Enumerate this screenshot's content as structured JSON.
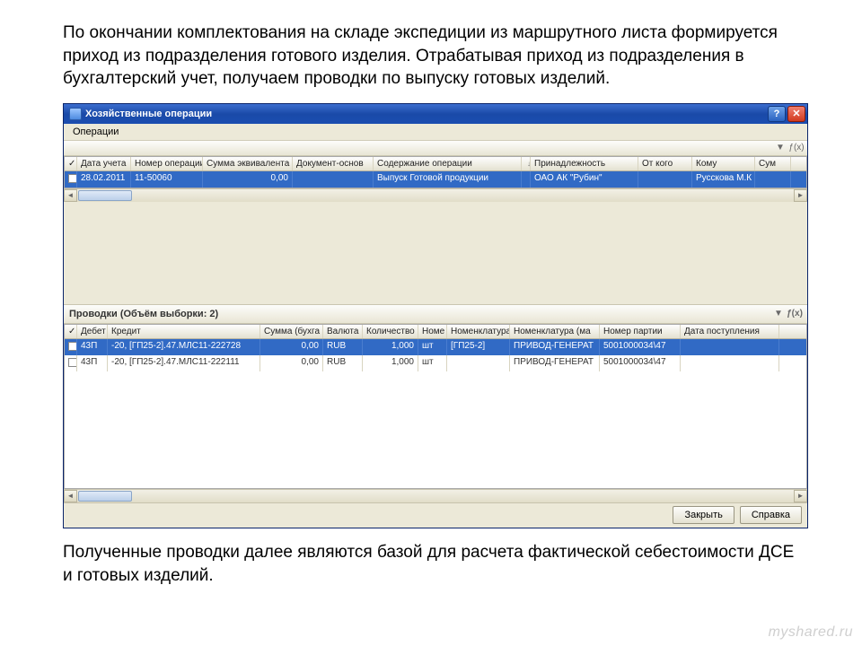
{
  "intro_text": "По окончании комплектования на складе экспедиции из маршрутного листа формируется приход из подразделения готового изделия. Отрабатывая приход из подразделения в бухгалтерский учет, получаем проводки по выпуску готовых изделий.",
  "outro_text": "Полученные проводки далее являются базой для расчета фактической себестоимости ДСЕ и готовых изделий.",
  "watermark": "myshared.ru",
  "window": {
    "title": "Хозяйственные операции",
    "menu": {
      "operations": "Операции"
    }
  },
  "toolbar": {
    "filter_icon": "▼",
    "fx_icon": "ƒ(x)"
  },
  "grid1": {
    "headers": {
      "check": "✓",
      "date": "Дата учета",
      "num": "Номер операции",
      "sum": "Сумма эквивалента",
      "doc": "Документ-основ",
      "content": "Содержание операции",
      "sort": "↓",
      "owner": "Принадлежность",
      "from": "От кого",
      "to": "Кому",
      "sumcol": "Сум"
    },
    "row": {
      "date": "28.02.2011",
      "num": "11-50060",
      "sum": "0,00",
      "doc": "",
      "content": "Выпуск Готовой продукции",
      "owner": "ОАО АК \"Рубин\"",
      "from": "",
      "to": "Русскова М.К",
      "sumcol": ""
    }
  },
  "panel2_title": "Проводки (Объём выборки: 2)",
  "grid2": {
    "headers": {
      "check": "✓",
      "debit": "Дебет",
      "credit": "Кредит",
      "sum": "Сумма (бухга",
      "currency": "Валюта",
      "qty": "Количество",
      "unit": "Номе",
      "nomen": "Номенклатура",
      "nomen_m": "Номенклатура (ма",
      "batch": "Номер партии",
      "date_in": "Дата поступления"
    },
    "rows": [
      {
        "sel": true,
        "debit": "43П",
        "credit": "-20, [ГП25-2].47.МЛС11-222728",
        "sum": "0,00",
        "currency": "RUB",
        "qty": "1,000",
        "unit": "шт",
        "nomen": "[ГП25-2]",
        "nomen_m": "ПРИВОД-ГЕНЕРАТ",
        "batch": "5001000034\\47",
        "date_in": ""
      },
      {
        "sel": false,
        "debit": "43П",
        "credit": "-20, [ГП25-2].47.МЛС11-222111",
        "sum": "0,00",
        "currency": "RUB",
        "qty": "1,000",
        "unit": "шт",
        "nomen": "",
        "nomen_m": "ПРИВОД-ГЕНЕРАТ",
        "batch": "5001000034\\47",
        "date_in": ""
      }
    ]
  },
  "buttons": {
    "close": "Закрыть",
    "help": "Справка"
  }
}
